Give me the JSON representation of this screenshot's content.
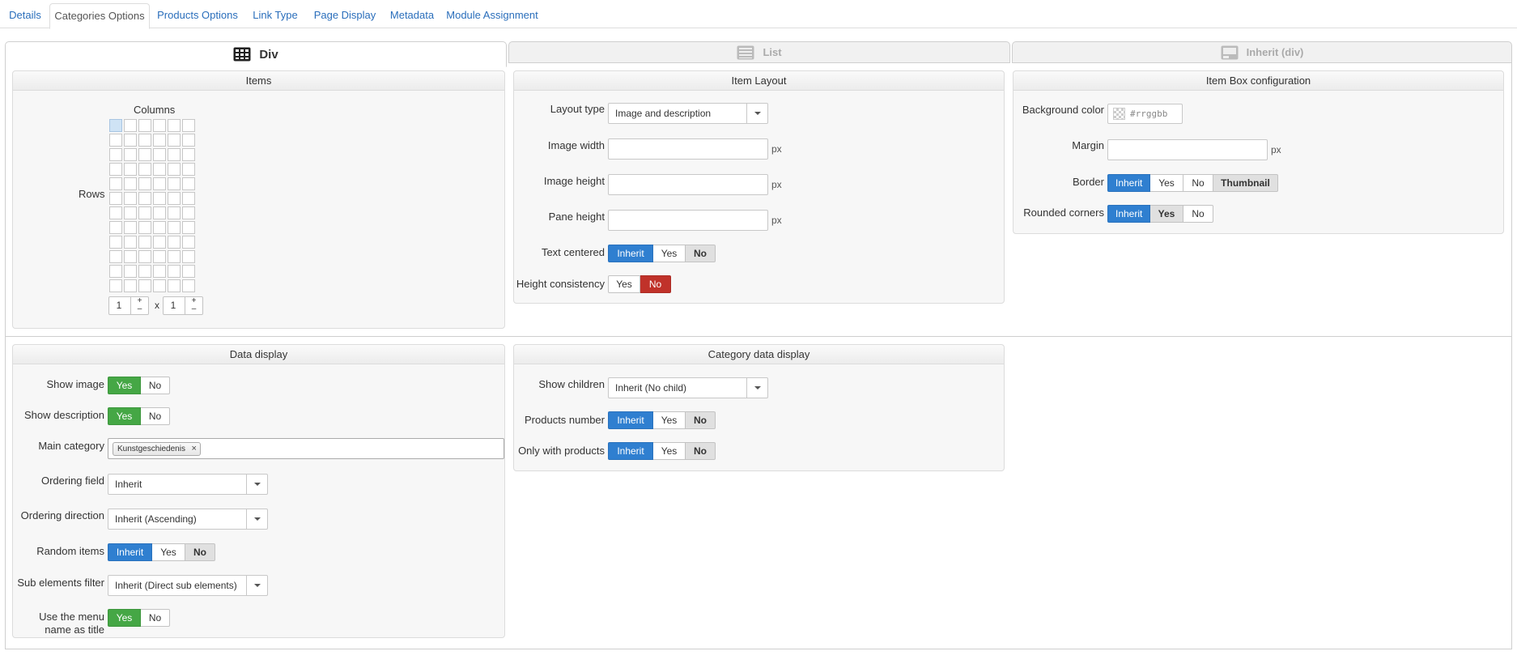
{
  "top_tabs": [
    "Details",
    "Categories Options",
    "Products Options",
    "Link Type",
    "Page Display",
    "Metadata",
    "Module Assignment"
  ],
  "view_tabs": {
    "div": "Div",
    "list": "List",
    "inherit": "Inherit (div)"
  },
  "items_panel": {
    "title": "Items",
    "columns_label": "Columns",
    "rows_label": "Rows",
    "rows_value": "1",
    "cols_value": "1",
    "times": "x",
    "plus": "+",
    "minus": "–"
  },
  "item_layout": {
    "title": "Item Layout",
    "layout_type_label": "Layout type",
    "layout_type_value": "Image and description",
    "image_width_label": "Image width",
    "image_height_label": "Image height",
    "pane_height_label": "Pane height",
    "unit": "px",
    "text_centered_label": "Text centered",
    "height_consistency_label": "Height consistency"
  },
  "item_box": {
    "title": "Item Box configuration",
    "bg_color_label": "Background color",
    "bg_color_placeholder": "#rrggbb",
    "margin_label": "Margin",
    "unit": "px",
    "border_label": "Border",
    "rounded_label": "Rounded corners",
    "thumbnail": "Thumbnail"
  },
  "data_display": {
    "title": "Data display",
    "show_image_label": "Show image",
    "show_description_label": "Show description",
    "main_category_label": "Main category",
    "main_category_tag": "Kunstgeschiedenis",
    "tag_remove": "×",
    "ordering_field_label": "Ordering field",
    "ordering_field_value": "Inherit",
    "ordering_direction_label": "Ordering direction",
    "ordering_direction_value": "Inherit (Ascending)",
    "random_items_label": "Random items",
    "sub_elements_label": "Sub elements filter",
    "sub_elements_value": "Inherit (Direct sub elements)",
    "menu_title_label_1": "Use the menu",
    "menu_title_label_2": "name as title"
  },
  "category_display": {
    "title": "Category data display",
    "show_children_label": "Show children",
    "show_children_value": "Inherit (No child)",
    "products_number_label": "Products number",
    "only_products_label": "Only with products"
  },
  "opts": {
    "inherit": "Inherit",
    "yes": "Yes",
    "no": "No"
  },
  "colors": {
    "accent_blue": "#2f7fd0",
    "green": "#45a745",
    "red": "#c0322a",
    "link": "#2a6ebb"
  }
}
